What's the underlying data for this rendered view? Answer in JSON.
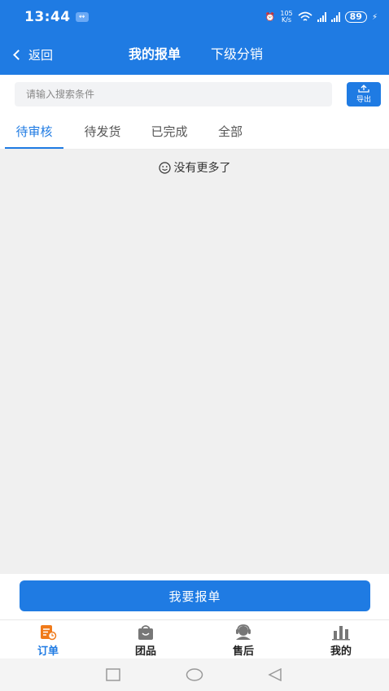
{
  "status_bar": {
    "time": "13:44",
    "net_speed_value": "105",
    "net_speed_unit": "K/s",
    "battery": "89"
  },
  "nav": {
    "back_label": "返回",
    "tab_my_reports": "我的报单",
    "tab_sub_distribution": "下级分销"
  },
  "search": {
    "placeholder": "请输入搜索条件",
    "export_label": "导出"
  },
  "tabs": [
    "待审核",
    "待发货",
    "已完成",
    "全部"
  ],
  "empty_message": "没有更多了",
  "report_button": "我要报单",
  "tabbar": [
    "订单",
    "团品",
    "售后",
    "我的"
  ],
  "colors": {
    "primary": "#1f7be3",
    "icon_orange": "#f07a1a",
    "icon_gray": "#777777"
  }
}
